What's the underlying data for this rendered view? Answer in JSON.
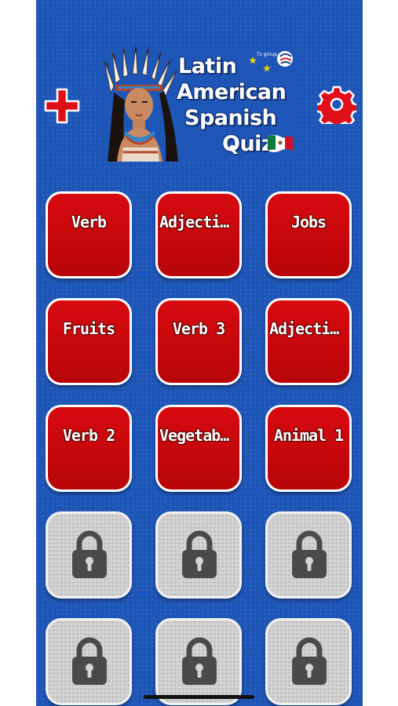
{
  "app": {
    "title_lines": [
      "Latin",
      "American",
      "Spanish",
      "Quiz"
    ],
    "logo_brand_text": "Tz group",
    "header": {
      "add_icon": "plus-icon",
      "settings_icon": "gear-icon"
    },
    "colors": {
      "background": "#1e56b8",
      "tile_red": "#d70a0f",
      "tile_locked": "#d4d4d4",
      "icon_red": "#e0101a"
    },
    "categories": [
      {
        "label": "Verb",
        "locked": false
      },
      {
        "label": "Adjectiv...",
        "locked": false
      },
      {
        "label": "Jobs",
        "locked": false
      },
      {
        "label": "Fruits",
        "locked": false
      },
      {
        "label": "Verb 3",
        "locked": false
      },
      {
        "label": "Adjectiv...",
        "locked": false
      },
      {
        "label": "Verb 2",
        "locked": false
      },
      {
        "label": "Vegetabl...",
        "locked": false
      },
      {
        "label": "Animal 1",
        "locked": false
      },
      {
        "label": "",
        "locked": true,
        "icon": "lock-icon"
      },
      {
        "label": "",
        "locked": true,
        "icon": "lock-icon"
      },
      {
        "label": "",
        "locked": true,
        "icon": "lock-icon"
      },
      {
        "label": "",
        "locked": true,
        "icon": "lock-icon"
      },
      {
        "label": "",
        "locked": true,
        "icon": "lock-icon"
      },
      {
        "label": "",
        "locked": true,
        "icon": "lock-icon"
      }
    ]
  }
}
